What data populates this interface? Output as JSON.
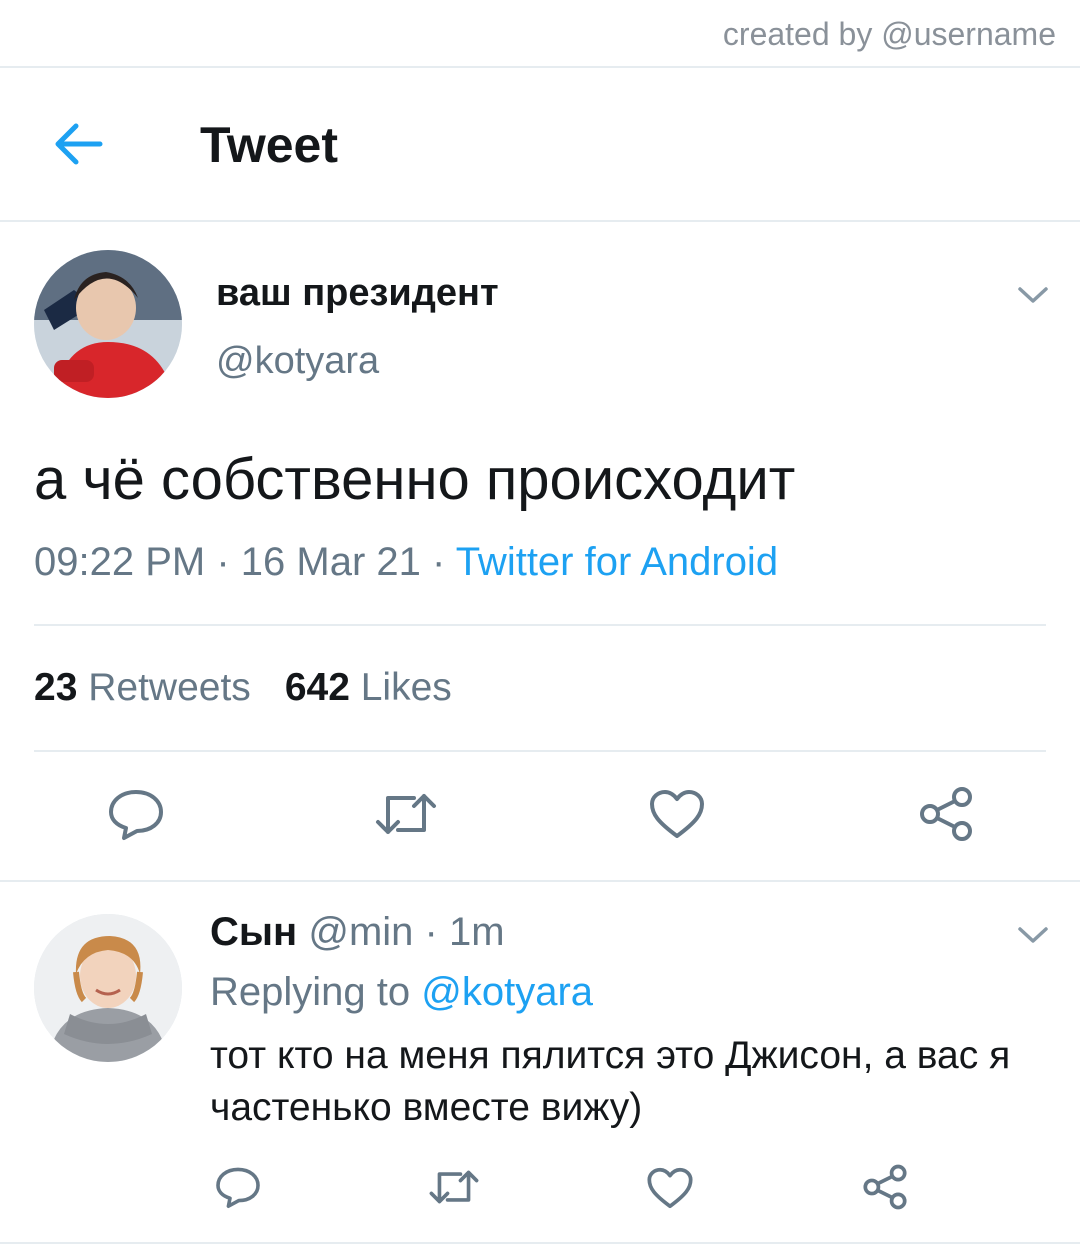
{
  "credit": "created by @username",
  "header": {
    "title": "Tweet",
    "back_icon": "arrow-left-icon"
  },
  "tweet": {
    "author_name": "ваш президент",
    "author_handle": "@kotyara",
    "text": "а чё собственно происходит",
    "time": "09:22 PM",
    "date": "16 Mar 21",
    "source": "Twitter for Android",
    "sep": " · ",
    "retweets_count": "23",
    "retweets_label": "Retweets",
    "likes_count": "642",
    "likes_label": "Likes"
  },
  "reply": {
    "author_name": "Сын",
    "author_handle": "@min",
    "age": "1m",
    "sep": " · ",
    "replying_label": "Replying to",
    "replying_handle": "@kotyara",
    "text": "тот кто на меня пялится это Джисон, а вас я частенько вместе вижу)"
  },
  "colors": {
    "accent": "#1da1f2",
    "muted": "#657786",
    "text": "#14171a",
    "divider": "#e6ecf0"
  },
  "actions": [
    "reply-icon",
    "retweet-icon",
    "like-icon",
    "share-icon"
  ]
}
